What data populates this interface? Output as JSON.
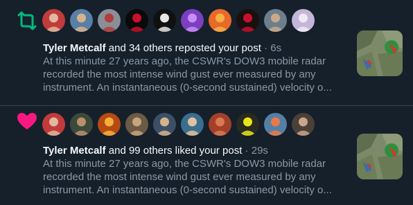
{
  "notifications": [
    {
      "type": "repost",
      "icon": "repost-icon",
      "accent_color": "#00ba7c",
      "user": "Tyler Metcalf",
      "rest": " and 34 others reposted your post",
      "dot": " · ",
      "time": "6s",
      "lines": [
        "At this minute 27 years ago, the CSWR's DOW3 mobile radar",
        "recorded the most intense wind gust ever measured by any",
        "instrument. An instantaneous (0-second sustained) velocity o..."
      ],
      "avatars": [
        {
          "bg": "#c23b3b",
          "fg": "#e0b8a0"
        },
        {
          "bg": "#5a7fa6",
          "fg": "#d6b38d"
        },
        {
          "bg": "#8a8f97",
          "fg": "#b33c3c"
        },
        {
          "bg": "#0a0a0a",
          "fg": "#c8102e"
        },
        {
          "bg": "#101010",
          "fg": "#e6e6e6"
        },
        {
          "bg": "#7b3fbf",
          "fg": "#c78dfb"
        },
        {
          "bg": "#e86a28",
          "fg": "#f5b04a"
        },
        {
          "bg": "#1a1010",
          "fg": "#c8102e"
        },
        {
          "bg": "#6d7e8d",
          "fg": "#c9a98a"
        },
        {
          "bg": "#c3b6d8",
          "fg": "#f1eaf6"
        }
      ]
    },
    {
      "type": "like",
      "icon": "heart-icon",
      "accent_color": "#f91880",
      "user": "Tyler Metcalf",
      "rest": " and 99 others liked your post",
      "dot": " · ",
      "time": "29s",
      "lines": [
        "At this minute 27 years ago, the CSWR's DOW3 mobile radar",
        "recorded the most intense wind gust ever measured by any",
        "instrument. An instantaneous (0-second sustained) velocity o..."
      ],
      "avatars": [
        {
          "bg": "#c23b3b",
          "fg": "#e0b8a0"
        },
        {
          "bg": "#3d4a3a",
          "fg": "#b89070"
        },
        {
          "bg": "#b64a12",
          "fg": "#f2b13c"
        },
        {
          "bg": "#6b5a45",
          "fg": "#c7a47b"
        },
        {
          "bg": "#3b4f66",
          "fg": "#d6b38d"
        },
        {
          "bg": "#3a6e8f",
          "fg": "#e3c19e"
        },
        {
          "bg": "#a2402a",
          "fg": "#d97a52"
        },
        {
          "bg": "#2a2a20",
          "fg": "#e8e61a"
        },
        {
          "bg": "#567fa6",
          "fg": "#e87a4a"
        },
        {
          "bg": "#4a4038",
          "fg": "#c9a68a"
        }
      ]
    }
  ]
}
